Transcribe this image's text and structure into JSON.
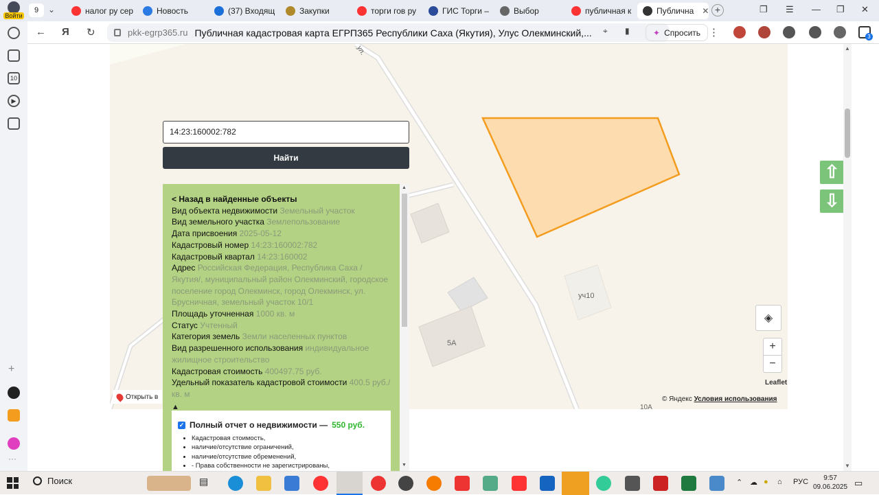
{
  "browser": {
    "profile_label": "Войти",
    "tab_count": "9",
    "tabs": [
      {
        "label": "налог ру сер",
        "color": "#f33"
      },
      {
        "label": "Новость",
        "color": "#2a7be4"
      },
      {
        "label": "(37) Входящ",
        "color": "#1a6fd8"
      },
      {
        "label": "Закупки",
        "color": "#b08a2a"
      },
      {
        "label": "торги гов ру",
        "color": "#f33"
      },
      {
        "label": "ГИС Торги –",
        "color": "#2a4a9a"
      },
      {
        "label": "Выбор",
        "color": "#666"
      },
      {
        "label": "публичная к",
        "color": "#f33"
      },
      {
        "label": "Публична",
        "color": "#333"
      }
    ],
    "domain": "pkk-egrp365.ru",
    "page_title": "Публичная кадастровая карта ЕГРП365 Республики Саха (Якутия), Улус Олекминский,...",
    "ask_label": "Спросить",
    "notif_badge": "3"
  },
  "search": {
    "value": "14:23:160002:782",
    "button_label": "Найти"
  },
  "info": {
    "back_label": "< Назад в найденные объекты",
    "rows": [
      {
        "label": "Вид объекта недвижимости",
        "value": "Земельный участок"
      },
      {
        "label": "Вид земельного участка",
        "value": "Землепользование"
      },
      {
        "label": "Дата присвоения",
        "value": "2025-05-12"
      },
      {
        "label": "Кадастровый номер",
        "value": "14:23:160002:782"
      },
      {
        "label": "Кадастровый квартал",
        "value": "14:23:160002"
      },
      {
        "label": "Адрес",
        "value": "Российская Федерация, Республика Саха /Якутия/, муниципальный район Олекминский, городское поселение город Олекминск, город Олекминск, ул. Брусничная, земельный участок 10/1"
      },
      {
        "label": "Площадь уточненная",
        "value": "1000 кв. м"
      },
      {
        "label": "Статус",
        "value": "Учтенный"
      },
      {
        "label": "Категория земель",
        "value": "Земли населенных пунктов"
      },
      {
        "label": "Вид разрешенного использования",
        "value": "индивидуальное жилищное строительство"
      },
      {
        "label": "Кадастровая стоимость",
        "value": "400497.75 руб."
      },
      {
        "label": "Удельный показатель кадастровой стоимости",
        "value": "400.5 руб./кв. м"
      }
    ],
    "collapse_glyph": "▲"
  },
  "report": {
    "title": "Полный отчет о недвижимости —",
    "price": "550 руб.",
    "items": [
      "Кадастровая стоимость,",
      "наличие/отсутствие ограничений,",
      "наличие/отсутствие обременений,",
      "- Права собственности не зарегистрированы,"
    ]
  },
  "map": {
    "street_label": "ул.",
    "labels": [
      "уч10",
      "5А",
      "10А"
    ],
    "open_in_label": "Открыть в",
    "leaflet_label": "Leaflet",
    "copyright_prefix": "© Яндекс",
    "terms_label": "Условия использования",
    "zoom_in": "+",
    "zoom_out": "−",
    "parcel_fill": "#fddcb0",
    "parcel_stroke": "#f39c1e"
  },
  "taskbar": {
    "search_label": "Поиск",
    "lang": "РУС",
    "time": "9:57",
    "date": "09.06.2025"
  }
}
